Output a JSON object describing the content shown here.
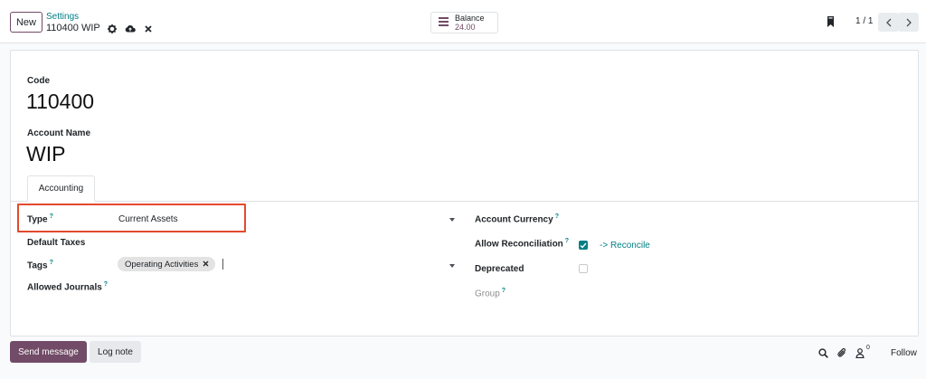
{
  "control_panel": {
    "new_label": "New",
    "breadcrumb_parent": "Settings",
    "record_name": "110400 WIP",
    "stat_button": {
      "label": "Balance",
      "value": "24.00"
    },
    "pager": "1 / 1"
  },
  "form": {
    "code_label": "Code",
    "code_value": "110400",
    "name_label": "Account Name",
    "name_value": "WIP",
    "tab_label": "Accounting",
    "left": {
      "type_label": "Type",
      "type_help": "?",
      "type_value": "Current Assets",
      "taxes_label": "Default Taxes",
      "tags_label": "Tags",
      "tags_help": "?",
      "tag_value": "Operating Activities",
      "journals_label": "Allowed Journals",
      "journals_help": "?"
    },
    "right": {
      "currency_label": "Account Currency",
      "currency_help": "?",
      "reconcile_label": "Allow Reconciliation",
      "reconcile_help": "?",
      "reconcile_checked": true,
      "reconcile_link": "-> Reconcile",
      "deprecated_label": "Deprecated",
      "deprecated_checked": false,
      "group_label": "Group",
      "group_help": "?"
    }
  },
  "chatter": {
    "send_message_label": "Send message",
    "log_note_label": "Log note",
    "follower_count": "0",
    "follow_label": "Follow"
  },
  "colors": {
    "brand": "#714b67",
    "link": "#017e84",
    "highlight": "#e34a2e"
  }
}
